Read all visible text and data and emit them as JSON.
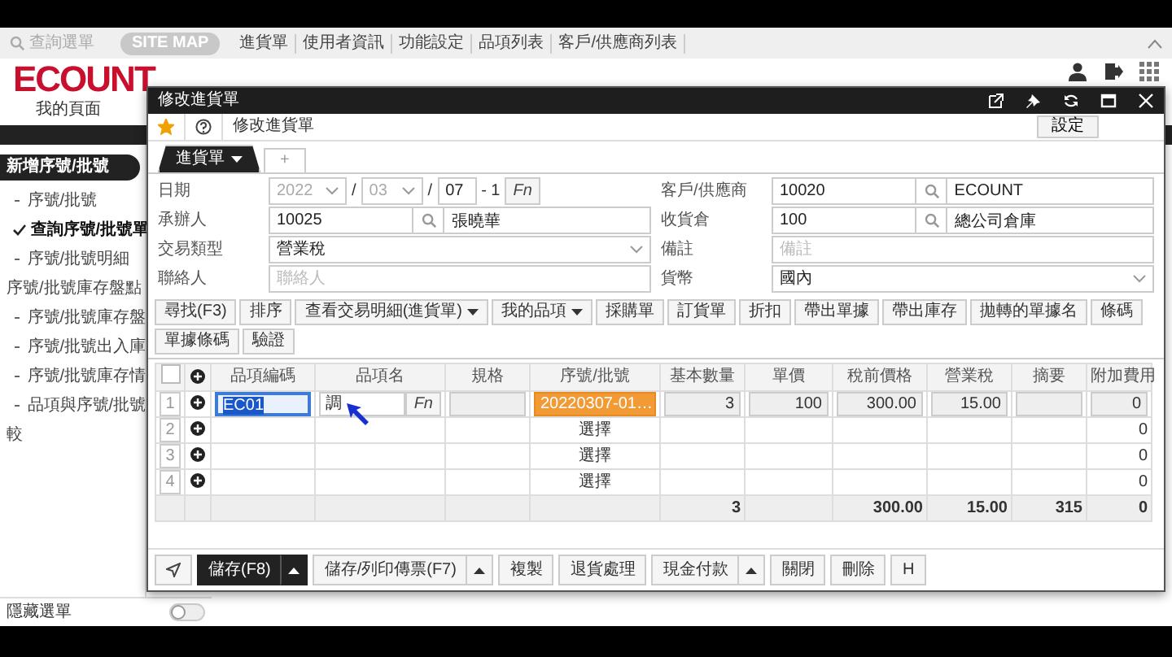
{
  "top_nav": {
    "search_placeholder": "查詢選單",
    "site_map": "SITE MAP",
    "links": [
      "進貨單",
      "使用者資訊",
      "功能設定",
      "品項列表",
      "客戶/供應商列表"
    ]
  },
  "header": {
    "logo": "ECOUNT",
    "my_page": "我的頁面"
  },
  "sidebar": {
    "title": "新增序號/批號",
    "items": [
      {
        "text": "序號/批號",
        "kind": "sub",
        "selected": false
      },
      {
        "text": "查詢序號/批號單",
        "kind": "sub",
        "selected": true
      },
      {
        "text": "序號/批號明細",
        "kind": "sub",
        "selected": false
      },
      {
        "text": "序號/批號庫存盤點",
        "kind": "group",
        "selected": false
      },
      {
        "text": "序號/批號庫存盤",
        "kind": "sub",
        "selected": false
      },
      {
        "text": "序號/批號出入庫",
        "kind": "sub",
        "selected": false
      },
      {
        "text": "序號/批號庫存情",
        "kind": "sub",
        "selected": false
      },
      {
        "text": "品項與序號/批號",
        "kind": "sub",
        "selected": false,
        "continuation": "較"
      }
    ],
    "hide_menu": {
      "label": "隱藏選單",
      "on": false
    }
  },
  "dialog": {
    "title": "修改進貨單",
    "favorite": true,
    "heading": "修改進貨單",
    "settings_button": "設定",
    "tabs": [
      {
        "label": "進貨單",
        "selected": true
      }
    ],
    "add_tab": "+",
    "form": [
      {
        "label": "日期",
        "kind": "date",
        "year": "2022",
        "month": "03",
        "day": "07",
        "separator": "/",
        "suffix": "- 1",
        "fn": "Fn"
      },
      {
        "label": "客戶/供應商",
        "kind": "lookup",
        "code": "10020",
        "name": "ECOUNT"
      },
      {
        "label": "承辦人",
        "kind": "lookup",
        "code": "10025",
        "name": "張曉華"
      },
      {
        "label": "收貨倉",
        "kind": "lookup",
        "code": "100",
        "name": "總公司倉庫"
      },
      {
        "label": "交易類型",
        "kind": "select",
        "value": "營業稅"
      },
      {
        "label": "備註",
        "kind": "text",
        "placeholder": "備註"
      },
      {
        "label": "聯絡人",
        "kind": "text",
        "placeholder": "聯絡人"
      },
      {
        "label": "貨幣",
        "kind": "select",
        "value": "國內"
      }
    ],
    "actions": [
      {
        "label": "尋找(F3)",
        "dropdown": false
      },
      {
        "label": "排序",
        "dropdown": false
      },
      {
        "label": "查看交易明細(進貨單)",
        "dropdown": true
      },
      {
        "label": "我的品項",
        "dropdown": true
      },
      {
        "label": "採購單",
        "dropdown": false
      },
      {
        "label": "訂貨單",
        "dropdown": false
      },
      {
        "label": "折扣",
        "dropdown": false
      },
      {
        "label": "帶出單據",
        "dropdown": false
      },
      {
        "label": "帶出庫存",
        "dropdown": false
      },
      {
        "label": "拋轉的單據名",
        "dropdown": false
      },
      {
        "label": "條碼",
        "dropdown": false
      },
      {
        "label": "單據條碼",
        "dropdown": false
      },
      {
        "label": "驗證",
        "dropdown": false
      }
    ],
    "table": {
      "select_all_checked": false,
      "columns": [
        "品項編碼",
        "品項名",
        "規格",
        "序號/批號",
        "基本數量",
        "單價",
        "稅前價格",
        "營業稅",
        "摘要",
        "附加費用"
      ],
      "rows": [
        {
          "no": "1",
          "kind": "entered",
          "item_code": "EC01",
          "code_highlighted": true,
          "item_name": "調",
          "fn": "Fn",
          "serial": "20220307-01…",
          "qty": "3",
          "price": "100",
          "pretax": "300.00",
          "tax": "15.00",
          "extra": "0"
        },
        {
          "no": "2",
          "kind": "blank",
          "serial": "選擇",
          "extra": "0"
        },
        {
          "no": "3",
          "kind": "blank",
          "serial": "選擇",
          "extra": "0"
        },
        {
          "no": "4",
          "kind": "blank",
          "serial": "選擇",
          "extra": "0"
        }
      ],
      "totals": {
        "qty": "3",
        "pretax": "300.00",
        "tax": "15.00",
        "summary": "315",
        "extra": "0"
      }
    },
    "buttons": [
      {
        "label": "儲存(F8)",
        "primary": true,
        "dropdown": true
      },
      {
        "label": "儲存/列印傳票(F7)",
        "primary": false,
        "dropdown": true
      },
      {
        "label": "複製",
        "primary": false,
        "dropdown": false
      },
      {
        "label": "退貨處理",
        "primary": false,
        "dropdown": false
      },
      {
        "label": "現金付款",
        "primary": false,
        "dropdown": true
      },
      {
        "label": "關閉",
        "primary": false,
        "dropdown": false
      },
      {
        "label": "刪除",
        "primary": false,
        "dropdown": false
      },
      {
        "label": "H",
        "primary": false,
        "dropdown": false
      }
    ]
  }
}
